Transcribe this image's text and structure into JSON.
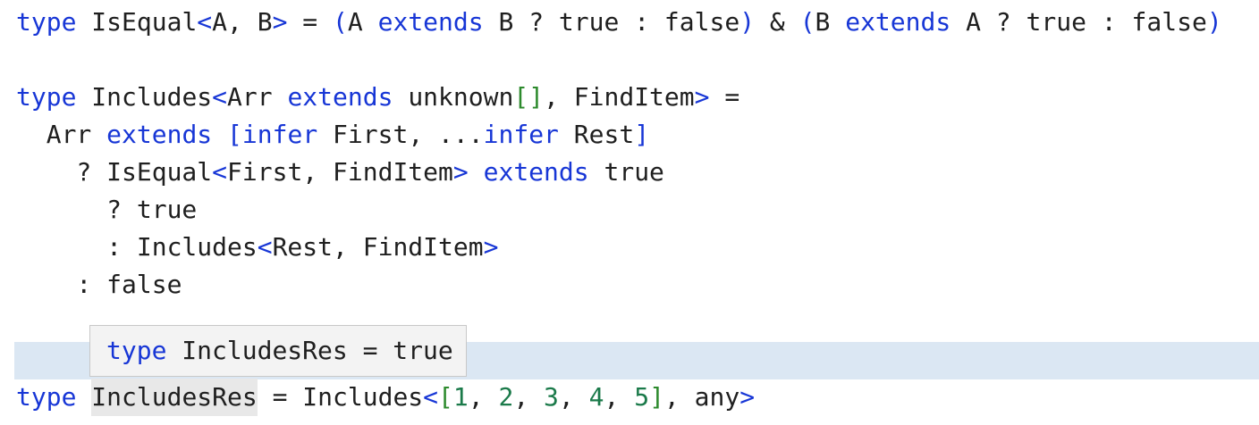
{
  "lines": {
    "l1": {
      "k_type": "type",
      "name": " IsEqual",
      "lt": "<",
      "params": "A, B",
      "gt": ">",
      "eq": " = ",
      "lp1": "(",
      "a1": "A ",
      "k_extends1": "extends",
      "rest1": " B ? true : false",
      "rp1": ")",
      "amp": " & ",
      "lp2": "(",
      "a2": "B ",
      "k_extends2": "extends",
      "rest2": " A ? true : false",
      "rp2": ")"
    },
    "l2": {
      "k_type": "type",
      "name": " Includes",
      "lt": "<",
      "arr": "Arr ",
      "k_extends": "extends",
      "unknown": " unknown",
      "brackets": "[]",
      "comma_find": ", FindItem",
      "gt": ">",
      "eq": " ="
    },
    "l3": {
      "indent": "  Arr ",
      "k_extends": "extends",
      "sp": " ",
      "lb": "[",
      "k_infer1": "infer",
      "first": " First, ...",
      "k_infer2": "infer",
      "rest": " Rest",
      "rb": "]"
    },
    "l4": {
      "prefix": "    ? IsEqual",
      "lt": "<",
      "args": "First, FindItem",
      "gt": ">",
      "sp": " ",
      "k_extends": "extends",
      "tail": " true"
    },
    "l5": {
      "text": "      ? true"
    },
    "l6": {
      "prefix": "      : Includes",
      "lt": "<",
      "args": "Rest, FindItem",
      "gt": ">"
    },
    "l7": {
      "text": "    : false"
    },
    "l8": {
      "k_type": "type",
      "sp": " ",
      "name": "IncludesRes",
      "eq": " = Includes",
      "lt": "<",
      "lb": "[",
      "n1": "1",
      "c1": ", ",
      "n2": "2",
      "c2": ", ",
      "n3": "3",
      "c3": ", ",
      "n4": "4",
      "c4": ", ",
      "n5": "5",
      "rb": "]",
      "any": ", any",
      "gt": ">"
    }
  },
  "hover": {
    "k_type": "type",
    "text": " IncludesRes = true"
  },
  "colors": {
    "keyword": "#1736d6",
    "bracket": "#2d8a2d",
    "number": "#1b7a4a",
    "text": "#1f1f1f",
    "line_highlight": "#dbe7f3",
    "hover_bg": "#f3f3f3"
  }
}
